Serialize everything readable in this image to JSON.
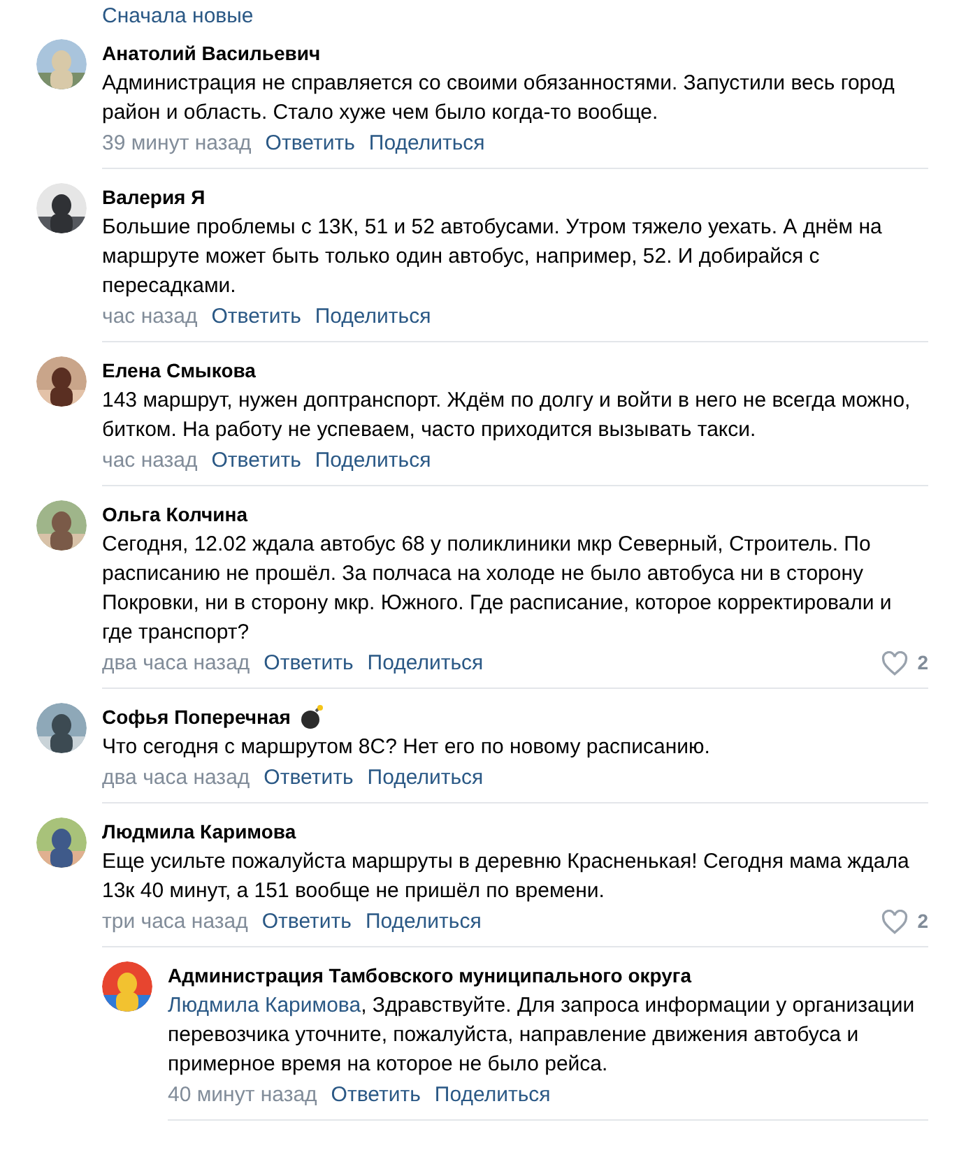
{
  "sort_link": {
    "label": "Сначала новые"
  },
  "comments": [
    {
      "author": "Анатолий Васильевич",
      "badge": false,
      "text": "Администрация не справляется со своими обязанностями. Запустили весь город район и область. Стало хуже чем было когда-то вообще.",
      "time": "39 минут назад",
      "reply": "Ответить",
      "share": "Поделиться"
    },
    {
      "author": "Валерия Я",
      "badge": false,
      "text": "Большие проблемы с 13К, 51 и 52 автобусами. Утром тяжело уехать. А днём на маршруте может быть только один автобус, например, 52. И добирайся с пересадками.",
      "time": "час назад",
      "reply": "Ответить",
      "share": "Поделиться"
    },
    {
      "author": "Елена Смыкова",
      "badge": false,
      "text": "143 маршрут, нужен доптранспорт. Ждём по долгу и войти в него не всегда можно, битком. На работу не успеваем, часто приходится вызывать такси.",
      "time": "час назад",
      "reply": "Ответить",
      "share": "Поделиться"
    },
    {
      "author": "Ольга Колчина",
      "badge": false,
      "text": "Сегодня, 12.02 ждала автобус 68 у поликлиники мкр Северный, Строитель. По расписанию не прошёл. За полчаса на холоде не было автобуса ни в сторону Покровки, ни в сторону мкр. Южного. Где расписание, которое корректировали и где транспорт?",
      "time": "два часа назад",
      "reply": "Ответить",
      "share": "Поделиться",
      "likes": "2"
    },
    {
      "author": "Софья Поперечная",
      "badge": true,
      "text": "Что сегодня с маршрутом 8С? Нет его по новому расписанию.",
      "time": "два часа назад",
      "reply": "Ответить",
      "share": "Поделиться"
    },
    {
      "author": "Людмила Каримова",
      "badge": false,
      "text": "Еще усильте пожалуйста маршруты в деревню Красненькая! Сегодня мама ждала 13к 40 минут, а 151 вообще не пришёл по времени.",
      "time": "три часа назад",
      "reply": "Ответить",
      "share": "Поделиться",
      "likes": "2",
      "children": [
        {
          "author": "Администрация Тамбовского муниципального округа",
          "badge": false,
          "mention": "Людмила Каримова",
          "text": ", Здравствуйте. Для запроса информации у организации перевозчика уточните, пожалуйста, направление движения автобуса и примерное время на которое не было рейса.",
          "time": "40 минут назад",
          "reply": "Ответить",
          "share": "Поделиться"
        }
      ]
    }
  ]
}
